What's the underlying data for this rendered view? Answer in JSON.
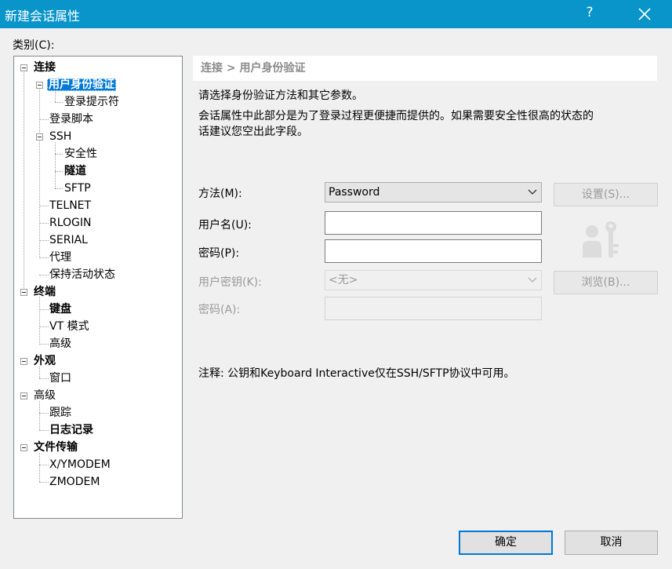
{
  "window": {
    "title": "新建会话属性",
    "help_glyph": "?"
  },
  "category_label": "类别(C):",
  "tree": [
    {
      "label": "连接"
    },
    {
      "label": "用户身份验证"
    },
    {
      "label": "登录提示符"
    },
    {
      "label": "登录脚本"
    },
    {
      "label": "SSH"
    },
    {
      "label": "安全性"
    },
    {
      "label": "隧道"
    },
    {
      "label": "SFTP"
    },
    {
      "label": "TELNET"
    },
    {
      "label": "RLOGIN"
    },
    {
      "label": "SERIAL"
    },
    {
      "label": "代理"
    },
    {
      "label": "保持活动状态"
    },
    {
      "label": "终端"
    },
    {
      "label": "键盘"
    },
    {
      "label": "VT 模式"
    },
    {
      "label": "高级"
    },
    {
      "label": "外观"
    },
    {
      "label": "窗口"
    },
    {
      "label": "高级"
    },
    {
      "label": "跟踪"
    },
    {
      "label": "日志记录"
    },
    {
      "label": "文件传输"
    },
    {
      "label": "X/YMODEM"
    },
    {
      "label": "ZMODEM"
    }
  ],
  "selected_item": "用户身份验证",
  "panel": {
    "breadcrumb": "连接 > 用户身份验证",
    "intro": "请选择身份验证方法和其它参数。",
    "desc_line1": "会话属性中此部分是为了登录过程更便捷而提供的。如果需要安全性很高的状态的",
    "desc_line2": "话建议您空出此字段。",
    "method_label": "方法(M):",
    "method_value": "Password",
    "username_label": "用户名(U):",
    "username_value": "",
    "password_label": "密码(P):",
    "password_value": "",
    "userkey_label": "用户密钥(K):",
    "userkey_value": "<无>",
    "passphrase_label": "密码(A):",
    "passphrase_value": "",
    "settings_button": "设置(S)...",
    "browse_button": "浏览(B)...",
    "note": "注释: 公钥和Keyboard Interactive仅在SSH/SFTP协议中可用。"
  },
  "buttons": {
    "ok": "确定",
    "cancel": "取消"
  },
  "colors": {
    "titlebar": "#0a95ca",
    "selection": "#0078d7"
  }
}
